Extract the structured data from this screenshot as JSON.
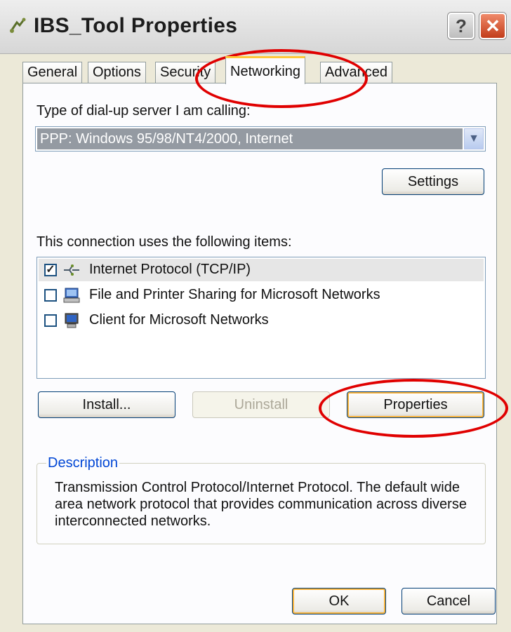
{
  "window": {
    "title": "IBS_Tool Properties",
    "help_button": "?",
    "close_button": "✕"
  },
  "tabs": [
    {
      "label": "General",
      "active": false
    },
    {
      "label": "Options",
      "active": false
    },
    {
      "label": "Security",
      "active": false
    },
    {
      "label": "Networking",
      "active": true
    },
    {
      "label": "Advanced",
      "active": false
    }
  ],
  "networking": {
    "server_type_label": "Type of dial-up server I am calling:",
    "server_type_value": "PPP: Windows 95/98/NT4/2000, Internet",
    "settings_button": "Settings",
    "items_label": "This connection uses the following items:",
    "items": [
      {
        "label": "Internet Protocol (TCP/IP)",
        "checked": true,
        "selected": true,
        "icon": "network-protocol-icon"
      },
      {
        "label": "File and Printer Sharing for Microsoft Networks",
        "checked": false,
        "selected": false,
        "icon": "network-service-icon"
      },
      {
        "label": "Client for Microsoft Networks",
        "checked": false,
        "selected": false,
        "icon": "network-client-icon"
      }
    ],
    "install_button": "Install...",
    "uninstall_button": "Uninstall",
    "properties_button": "Properties",
    "description_title": "Description",
    "description_text": "Transmission Control Protocol/Internet Protocol. The default wide area network protocol that provides communication across diverse interconnected networks."
  },
  "footer": {
    "ok_button": "OK",
    "cancel_button": "Cancel"
  },
  "colors": {
    "highlight_ring": "#e00000",
    "dialog_background": "#ECE9D8",
    "focus_border": "#f8b33c"
  }
}
